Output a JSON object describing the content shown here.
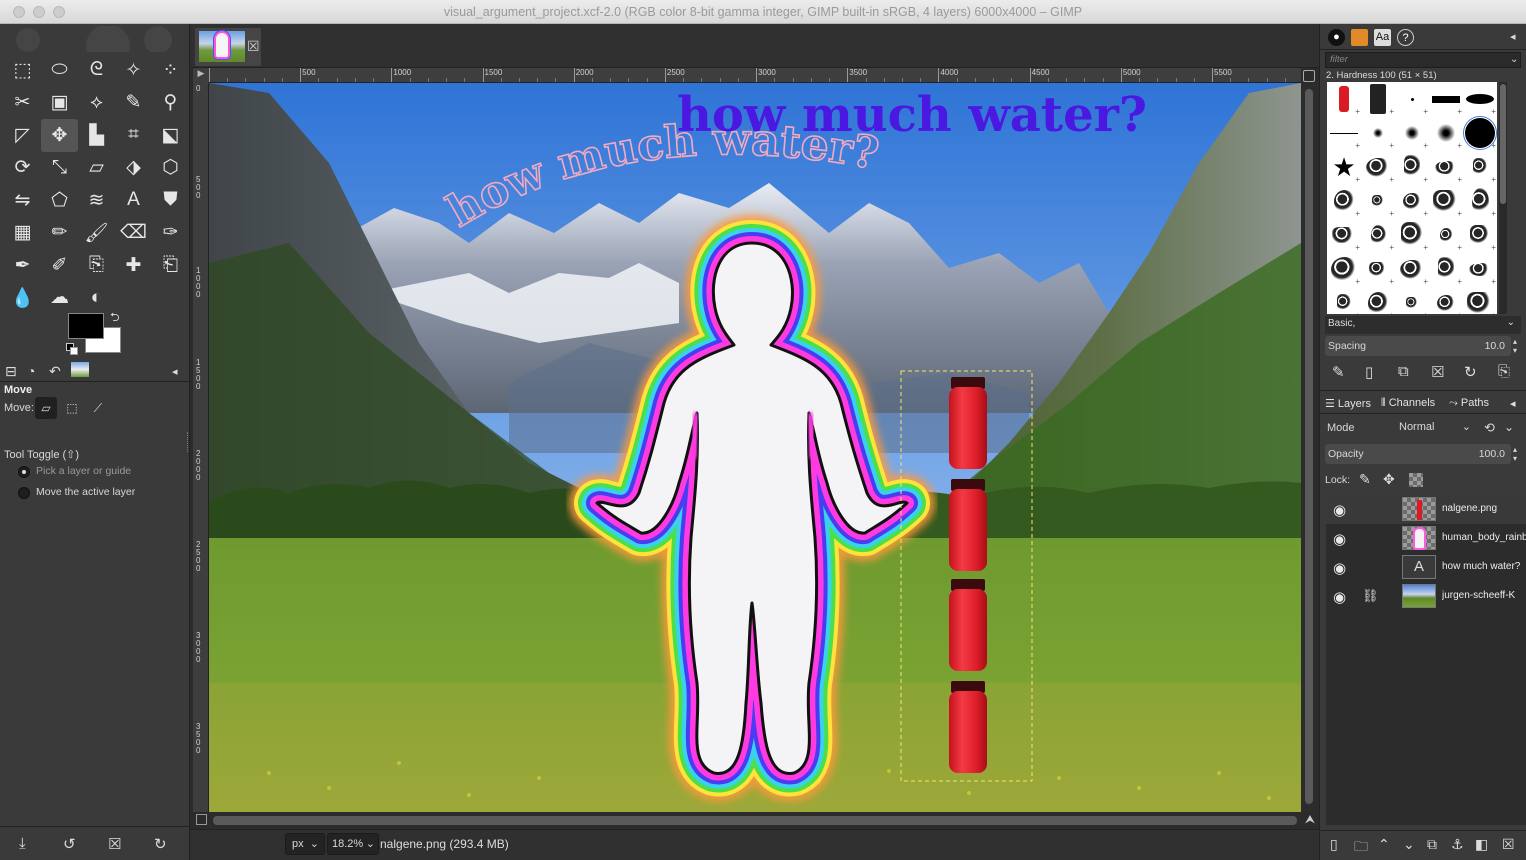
{
  "window": {
    "title": "visual_argument_project.xcf-2.0 (RGB color 8-bit gamma integer, GIMP built-in sRGB, 4 layers) 6000x4000 – GIMP"
  },
  "toolbox": {
    "tools": [
      "rect-select-icon",
      "ellipse-select-icon",
      "free-select-icon",
      "fuzzy-select-icon",
      "select-by-color-icon",
      "scissors-select-icon",
      "foreground-select-icon",
      "paths-icon",
      "color-picker-icon",
      "zoom-icon",
      "measure-icon",
      "move-icon",
      "align-icon",
      "crop-icon",
      "unified-transform-icon",
      "rotate-icon",
      "scale-icon",
      "shear-icon",
      "perspective-icon",
      "3d-transform-icon",
      "flip-icon",
      "cage-icon",
      "warp-icon",
      "text-icon",
      "bucket-fill-icon",
      "gradient-icon",
      "pencil-icon",
      "paintbrush-icon",
      "eraser-icon",
      "airbrush-icon",
      "ink-icon",
      "mypaint-brush-icon",
      "clone-icon",
      "heal-icon",
      "perspective-clone-icon",
      "blur-icon",
      "smudge-icon",
      "dodge-burn-icon"
    ],
    "tool_glyphs": [
      "⬚",
      "⬭",
      "ᘓ",
      "✧",
      "⁘",
      "✂",
      "▣",
      "⟡",
      "✎",
      "⚲",
      "◸",
      "✥",
      "▙",
      "⌗",
      "⬕",
      "⟳",
      "⤡",
      "▱",
      "⬗",
      "⬡",
      "⇋",
      "⬠",
      "≋",
      "A",
      "⛊",
      "▦",
      "✏",
      "🖌",
      "⌫",
      "✑",
      "✒",
      "✐",
      "⎘",
      "✚",
      "⎗",
      "💧",
      "☁",
      "◐"
    ],
    "active_tool_index": 11,
    "fg_color": "#000000",
    "bg_color": "#ffffff"
  },
  "tool_options": {
    "title": "Move",
    "move_label": "Move:",
    "toggle_label": "Tool Toggle  (⇧)",
    "options": [
      "Pick a layer or guide",
      "Move the active layer"
    ],
    "selected_option": 0
  },
  "image_tab": {
    "close_glyph": "☒"
  },
  "rulers": {
    "corner": "▶",
    "top_labels": [
      "500",
      "1000",
      "1500",
      "2000",
      "2500",
      "3000",
      "3500",
      "4000",
      "4500",
      "5000",
      "5500"
    ],
    "left_labels": [
      "0",
      "5\n0\n0",
      "1\n0\n0\n0",
      "1\n5\n0\n0",
      "2\n0\n0\n0",
      "2\n5\n0\n0",
      "3\n0\n0\n0",
      "3\n5\n0\n0"
    ]
  },
  "canvas": {
    "headline": "how much water?",
    "arc_text": "how much water?",
    "headline_color": "#4a18e0",
    "arc_text_color": "#f3a9c0"
  },
  "statusbar": {
    "unit": "px",
    "zoom": "18.2%",
    "info": "nalgene.png (293.4 MB)"
  },
  "brushes": {
    "filter_placeholder": "filter",
    "current": "2. Hardness 100 (51 × 51)",
    "set": "Basic,",
    "spacing_label": "Spacing",
    "spacing_value": "10.0"
  },
  "layers_panel": {
    "tabs": [
      "Layers",
      "Channels",
      "Paths"
    ],
    "mode_label": "Mode",
    "mode_value": "Normal",
    "opacity_label": "Opacity",
    "opacity_value": "100.0",
    "lock_label": "Lock:",
    "layers": [
      {
        "name": "nalgene.png",
        "visible": true,
        "chained": false,
        "selected": true,
        "thumb": "bottles"
      },
      {
        "name": "human_body_rainbow",
        "visible": true,
        "chained": false,
        "selected": false,
        "thumb": "body"
      },
      {
        "name": "how much water?",
        "visible": true,
        "chained": false,
        "selected": false,
        "thumb": "text"
      },
      {
        "name": "jurgen-scheeff-K",
        "visible": true,
        "chained": true,
        "selected": false,
        "thumb": "landscape"
      }
    ]
  }
}
